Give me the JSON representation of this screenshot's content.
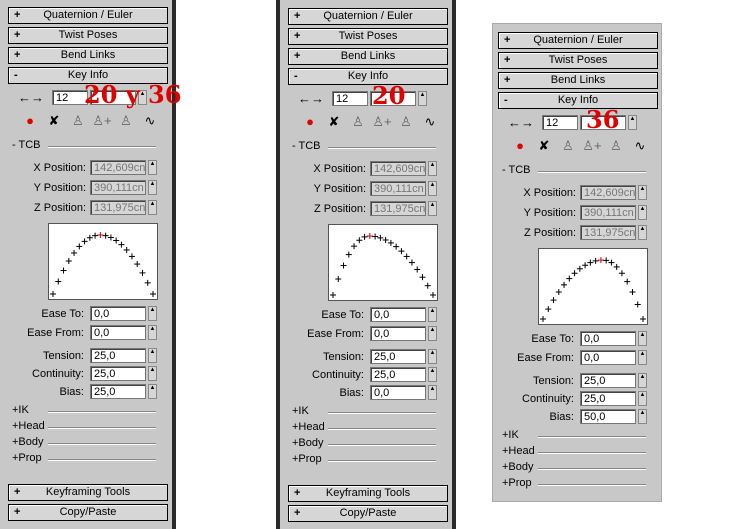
{
  "rollouts": {
    "quaternion": "Quaternion / Euler",
    "twist": "Twist Poses",
    "bend": "Bend Links",
    "key_info": "Key Info",
    "keyframing": "Keyframing Tools",
    "copy_paste": "Copy/Paste"
  },
  "signs": {
    "plus": "+",
    "minus": "-"
  },
  "nav": {
    "prev_next": "←→"
  },
  "icons": {
    "record": "●",
    "delete": "✘",
    "key": "♙",
    "key_plus": "♙+",
    "key_b": "♙",
    "curve": "∿"
  },
  "labels": {
    "tcb": "- TCB",
    "x_pos": "X Position:",
    "y_pos": "Y Position:",
    "z_pos": "Z Position:",
    "ease_to": "Ease To:",
    "ease_from": "Ease From:",
    "tension": "Tension:",
    "continuity": "Continuity:",
    "bias": "Bias:"
  },
  "extras": [
    "+IK",
    "+Head",
    "+Body",
    "+Prop"
  ],
  "spinner_arrows": {
    "up": "▲",
    "down": "▼"
  },
  "panels": [
    {
      "frame": "12",
      "key_field": "",
      "overlay": "20 y 36",
      "x_pos": "142,609cn",
      "y_pos": "390,111cn",
      "z_pos": "131,975cn",
      "ease_to": "0,0",
      "ease_from": "0,0",
      "tension": "25,0",
      "continuity": "25,0",
      "bias": "25,0"
    },
    {
      "frame": "12",
      "key_field": "",
      "overlay": "20",
      "x_pos": "142,609cn",
      "y_pos": "390,111cn",
      "z_pos": "131,975cn",
      "ease_to": "0,0",
      "ease_from": "0,0",
      "tension": "25,0",
      "continuity": "25,0",
      "bias": "0,0"
    },
    {
      "frame": "12",
      "key_field": "",
      "overlay": "36",
      "x_pos": "142,609cn",
      "y_pos": "390,111cn",
      "z_pos": "131,975cn",
      "ease_to": "0,0",
      "ease_from": "0,0",
      "tension": "25,0",
      "continuity": "25,0",
      "bias": "50,0"
    }
  ],
  "curve_peaks": [
    0.47,
    0.36,
    0.6
  ]
}
